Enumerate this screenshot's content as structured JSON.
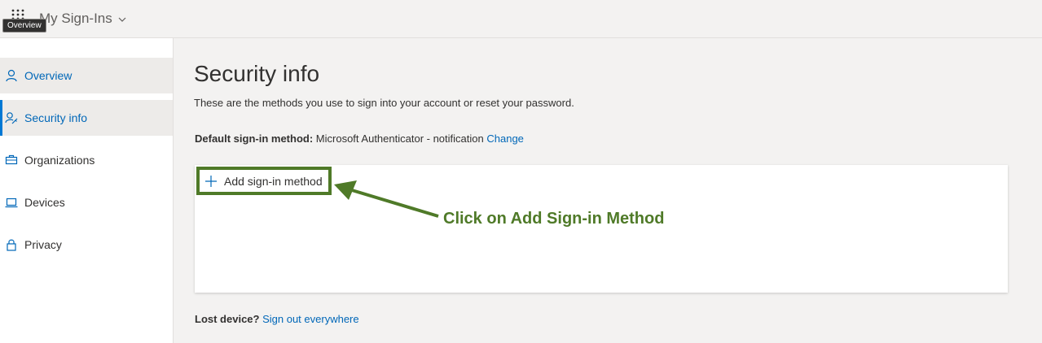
{
  "header": {
    "app_title": "My Sign-Ins",
    "tooltip": "Overview"
  },
  "sidebar": {
    "items": [
      {
        "label": "Overview",
        "icon": "person-icon"
      },
      {
        "label": "Security info",
        "icon": "person-key-icon"
      },
      {
        "label": "Organizations",
        "icon": "briefcase-icon"
      },
      {
        "label": "Devices",
        "icon": "laptop-icon"
      },
      {
        "label": "Privacy",
        "icon": "lock-icon"
      }
    ]
  },
  "main": {
    "title": "Security info",
    "subtitle": "These are the methods you use to sign into your account or reset your password.",
    "default_method_label": "Default sign-in method:",
    "default_method_value": "Microsoft Authenticator - notification",
    "change_link": "Change",
    "add_method_button": "Add sign-in method",
    "lost_device_label": "Lost device?",
    "sign_out_link": "Sign out everywhere"
  },
  "annotation": {
    "callout": "Click on Add Sign-in Method",
    "color": "#4f7a28"
  },
  "colors": {
    "accent": "#0067b8",
    "annotation": "#4f7a28"
  }
}
